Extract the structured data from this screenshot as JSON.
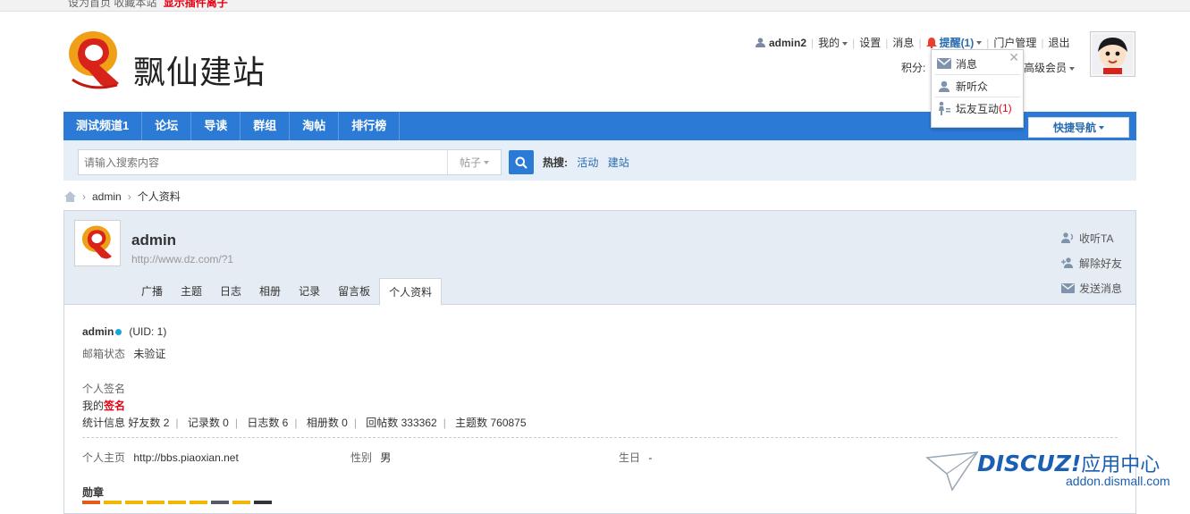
{
  "topbar": {
    "set_home": "设为首页",
    "bookmark": "收藏本站",
    "promo": "显示插件离子"
  },
  "site": {
    "name": "飘仙建站"
  },
  "usernav": {
    "username": "admin2",
    "mine": "我的",
    "settings": "设置",
    "messages": "消息",
    "remind": "提醒(1)",
    "portal_admin": "门户管理",
    "logout": "退出",
    "points_label": "积分:",
    "level": "高级会员"
  },
  "remind_menu": {
    "item1": "消息",
    "item2": "新听众",
    "item3_label": "坛友互动",
    "item3_count": "(1)"
  },
  "nav": {
    "items": [
      "测试频道1",
      "论坛",
      "导读",
      "群组",
      "淘帖",
      "排行榜"
    ],
    "quick": "快捷导航"
  },
  "search": {
    "placeholder": "请输入搜索内容",
    "type": "帖子",
    "hot_label": "热搜:",
    "hot1": "活动",
    "hot2": "建站"
  },
  "breadcrumb": {
    "user": "admin",
    "page": "个人资料"
  },
  "profile": {
    "name": "admin",
    "url": "http://www.dz.com/?1",
    "tabs": [
      "广播",
      "主题",
      "日志",
      "相册",
      "记录",
      "留言板",
      "个人资料"
    ],
    "actions": {
      "follow": "收听TA",
      "unfriend": "解除好友",
      "send_msg": "发送消息"
    }
  },
  "info": {
    "name": "admin",
    "uid": "(UID: 1)",
    "email_label": "邮箱状态",
    "email_value": "未验证",
    "sig_label": "个人签名",
    "sig_prefix": "我的",
    "sig_red": "签名",
    "stats_label": "统计信息",
    "friends": "好友数 2",
    "records": "记录数 0",
    "blogs": "日志数 6",
    "albums": "相册数 0",
    "replies": "回帖数 333362",
    "threads": "主题数 760875",
    "homepage_label": "个人主页",
    "homepage_value": "http://bbs.piaoxian.net",
    "gender_label": "性别",
    "gender_value": "男",
    "birthday_label": "生日",
    "birthday_value": "-",
    "medals_label": "勋章"
  },
  "medal_colors": [
    "#e25b1b",
    "#f2b705",
    "#f2b705",
    "#f2b705",
    "#f2b705",
    "#f2b705",
    "#555a66",
    "#f2b705",
    "#333333"
  ],
  "watermark": {
    "brand": "DISCUZ!",
    "cn": "应用中心",
    "url": "addon.dismall.com"
  },
  "colors": {
    "nav_blue": "#2b7ad6",
    "accent_red": "#e60012",
    "link_blue": "#2b6cb0"
  }
}
